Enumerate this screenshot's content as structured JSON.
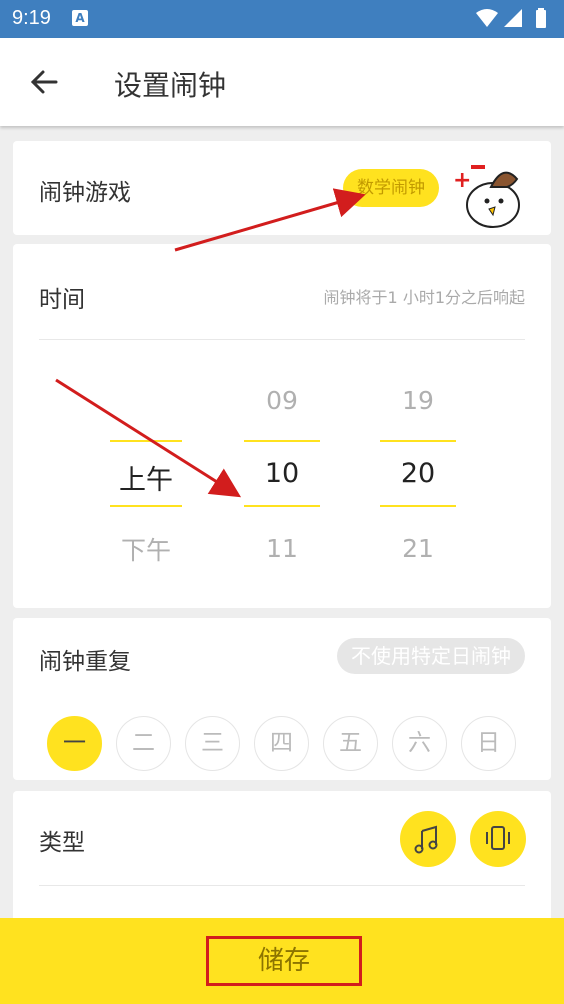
{
  "status_bar": {
    "time": "9:19",
    "app_icon_letter": "A"
  },
  "toolbar": {
    "title": "设置闹钟"
  },
  "game_card": {
    "label": "闹钟游戏",
    "badge": "数学闹钟"
  },
  "time_card": {
    "label": "时间",
    "hint": "闹钟将于1 小时1分之后响起",
    "ampm": {
      "current": "上午",
      "next": "下午"
    },
    "hour": {
      "prev": "09",
      "current": "10",
      "next": "11"
    },
    "minute": {
      "prev": "19",
      "current": "20",
      "next": "21"
    }
  },
  "repeat_card": {
    "label": "闹钟重复",
    "badge": "不使用特定日闹钟",
    "days": [
      "一",
      "二",
      "三",
      "四",
      "五",
      "六",
      "日"
    ],
    "active_day": "一"
  },
  "type_card": {
    "label": "类型",
    "icons": [
      "music-note-icon",
      "vibrate-phone-icon"
    ]
  },
  "footer": {
    "save_label": "储存"
  },
  "colors": {
    "accent": "#ffe21f",
    "status_bar": "#3f7fbf",
    "annotation": "#d21d1d"
  }
}
